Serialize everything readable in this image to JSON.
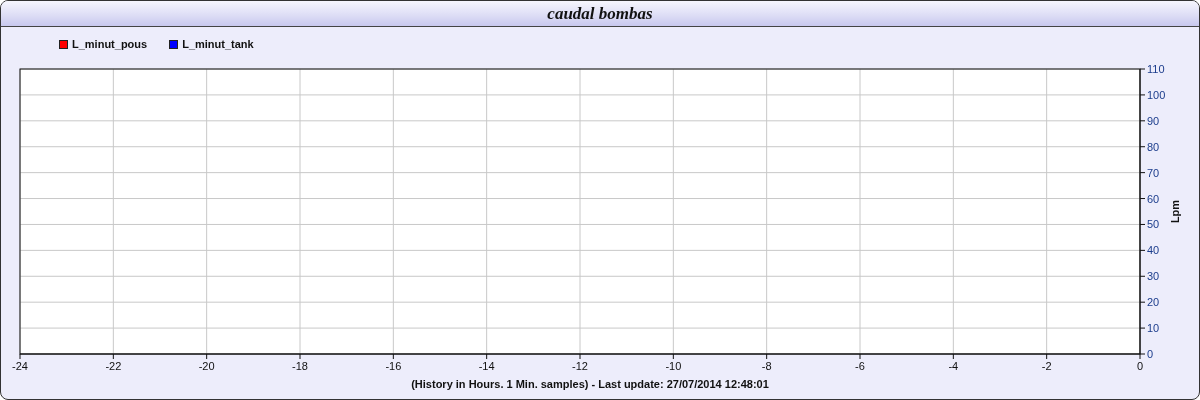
{
  "panel": {
    "title": "caudal bombas"
  },
  "chart_data": {
    "type": "line",
    "xlabel": "(History in Hours. 1 Min. samples) - Last update: 27/07/2014 12:48:01",
    "ylabel": "Lpm",
    "grid": true,
    "categories": [
      "-24",
      "-22",
      "-20",
      "-18",
      "-16",
      "-14",
      "-12",
      "-10",
      "-8",
      "-6",
      "-4",
      "-2",
      "0"
    ],
    "series": [
      {
        "name": "L_minut_pous",
        "color": "#ff0000",
        "values": [
          null,
          null,
          null,
          null,
          null,
          null,
          null,
          null,
          null,
          null,
          null,
          null,
          null
        ]
      },
      {
        "name": "L_minut_tank",
        "color": "#0000ff",
        "values": [
          null,
          null,
          null,
          null,
          null,
          null,
          null,
          null,
          null,
          null,
          null,
          null,
          null
        ]
      }
    ],
    "ylim": [
      0,
      110
    ],
    "yticks": [
      0,
      10,
      20,
      30,
      40,
      50,
      60,
      70,
      80,
      90,
      100,
      110
    ]
  }
}
